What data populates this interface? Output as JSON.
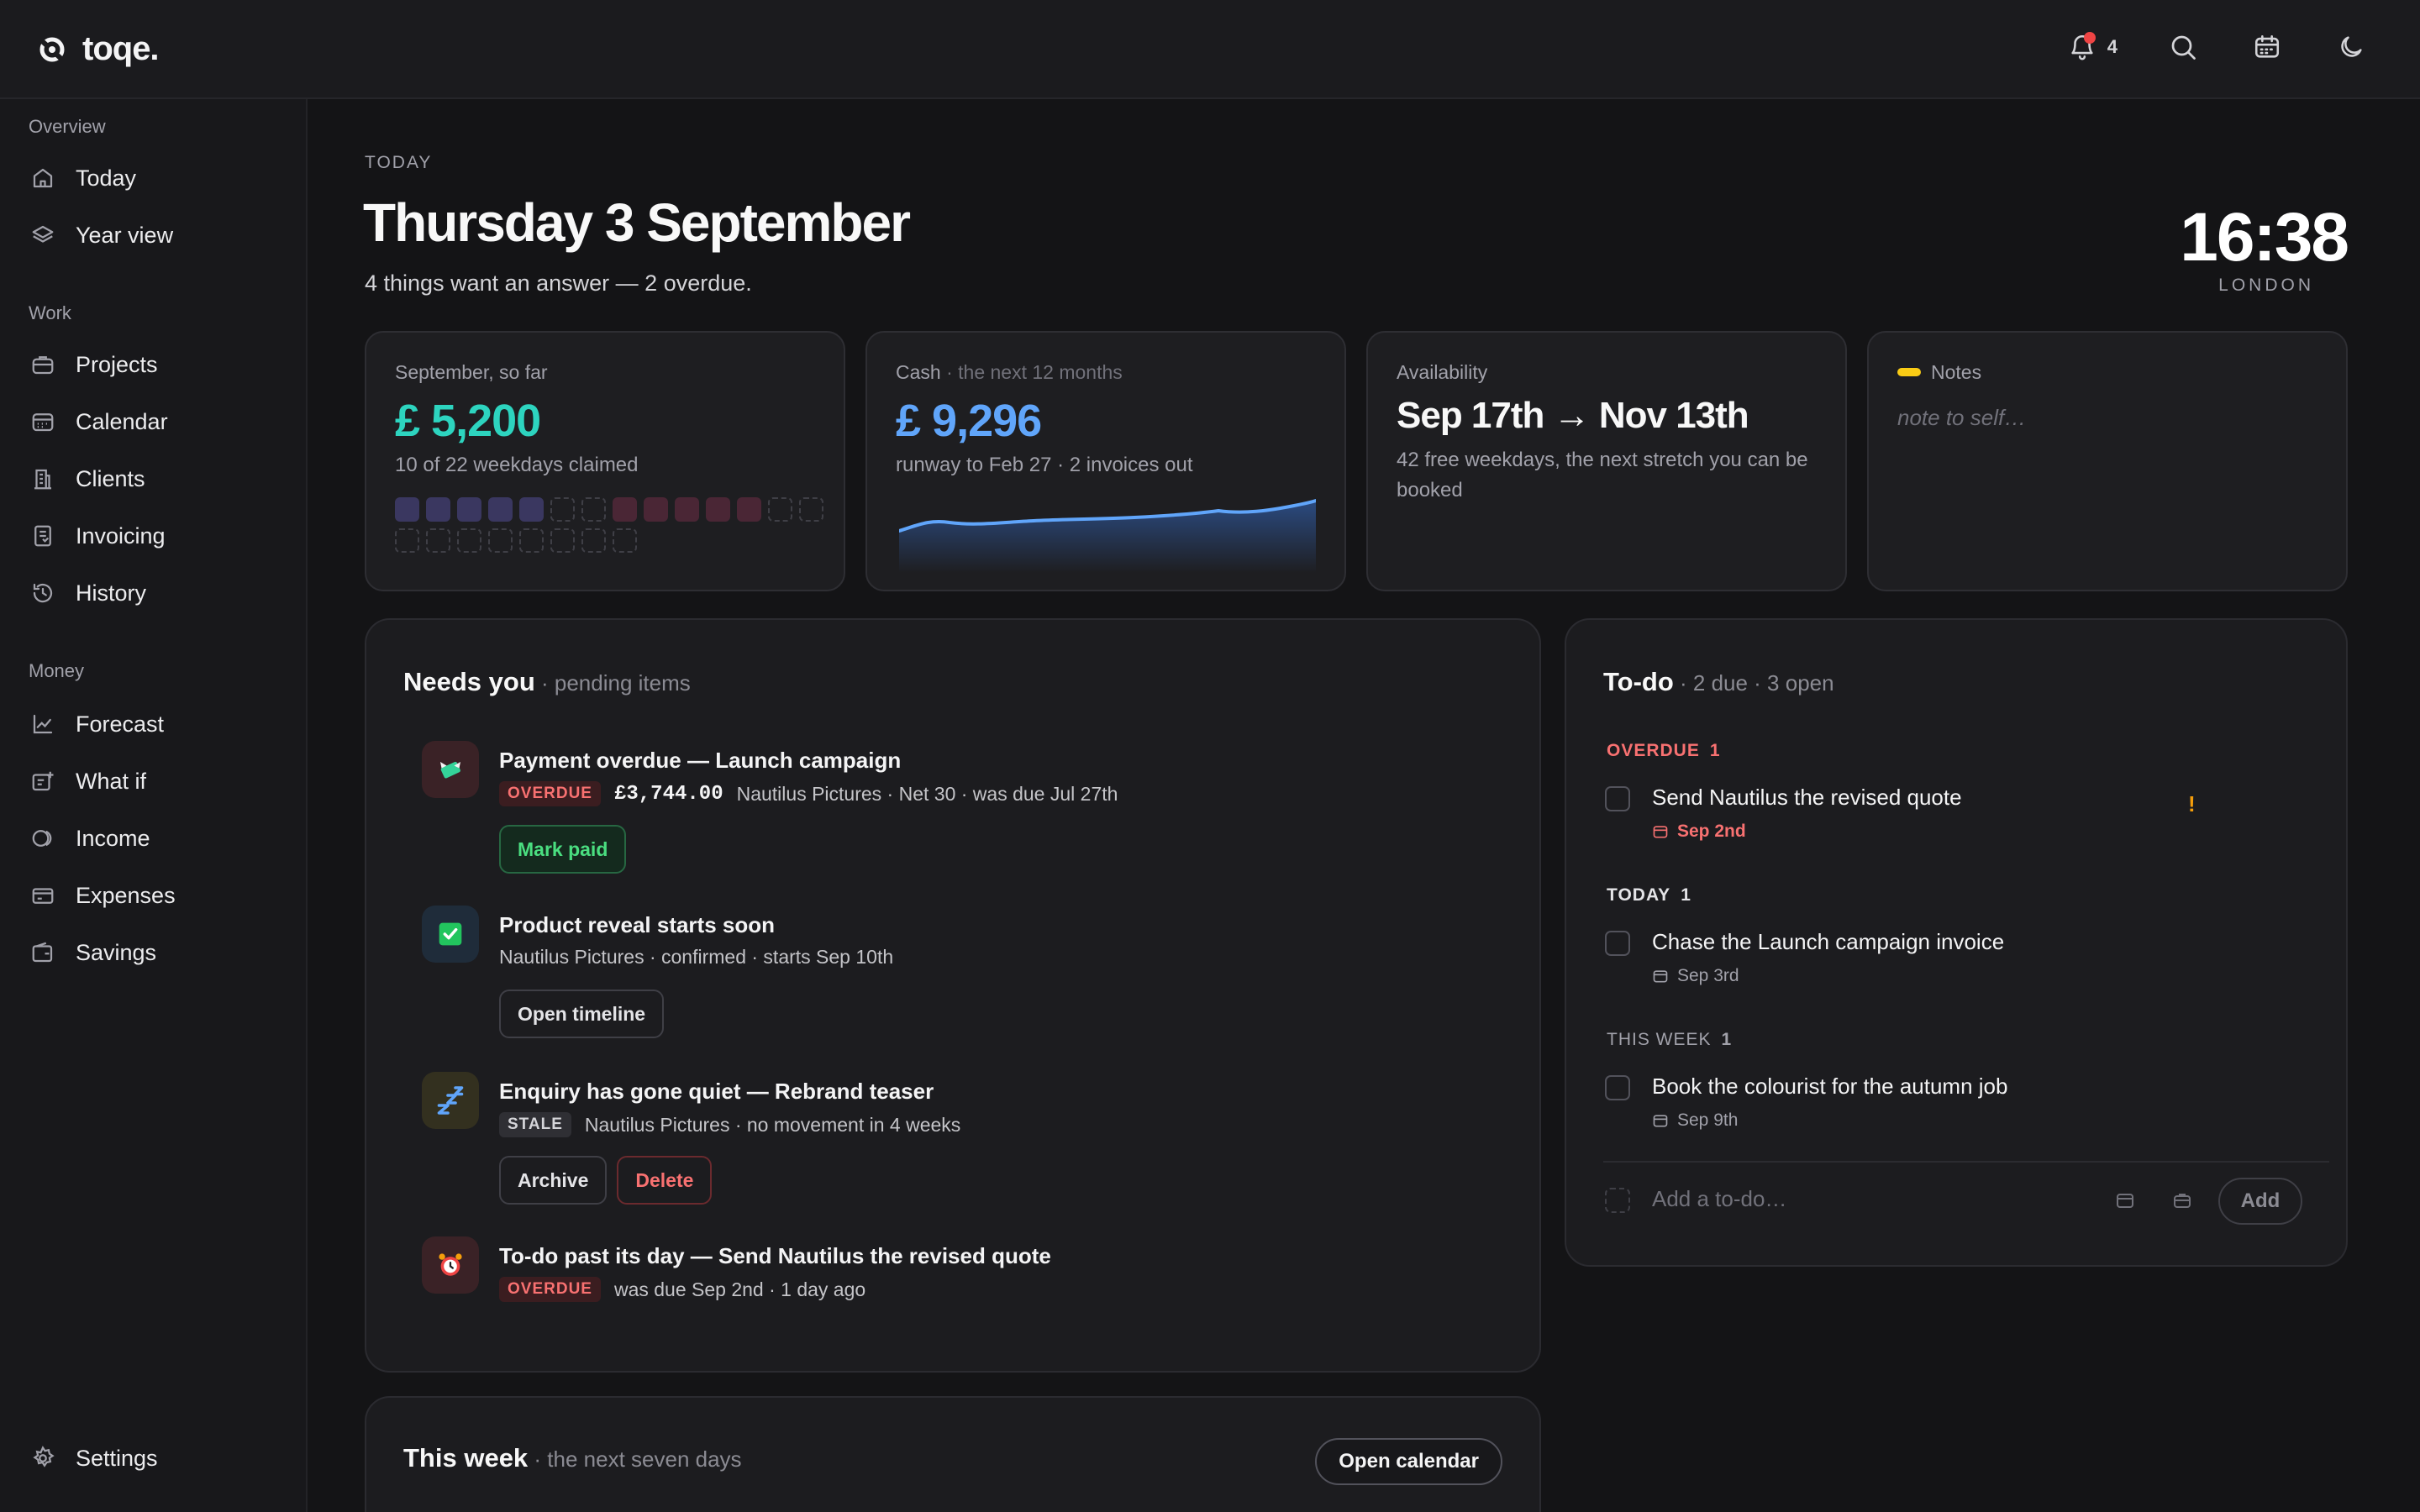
{
  "app": {
    "name": "toqe."
  },
  "topbar": {
    "notification_count": "4",
    "icons": [
      "bell-icon",
      "search-icon",
      "calendar-icon",
      "moon-icon"
    ]
  },
  "sidebar": {
    "sections": [
      {
        "label": "Overview",
        "items": [
          {
            "label": "Today",
            "icon": "home-icon"
          },
          {
            "label": "Year view",
            "icon": "layers-icon"
          }
        ]
      },
      {
        "label": "Work",
        "items": [
          {
            "label": "Projects",
            "icon": "briefcase-icon"
          },
          {
            "label": "Calendar",
            "icon": "calendar-icon"
          },
          {
            "label": "Clients",
            "icon": "building-icon"
          },
          {
            "label": "Invoicing",
            "icon": "receipt-icon"
          },
          {
            "label": "History",
            "icon": "history-icon"
          }
        ]
      },
      {
        "label": "Money",
        "items": [
          {
            "label": "Forecast",
            "icon": "trend-icon"
          },
          {
            "label": "What if",
            "icon": "scenario-icon"
          },
          {
            "label": "Income",
            "icon": "coin-icon"
          },
          {
            "label": "Expenses",
            "icon": "card-icon"
          },
          {
            "label": "Savings",
            "icon": "wallet-icon"
          }
        ]
      }
    ],
    "settings": {
      "label": "Settings",
      "icon": "gear-icon"
    }
  },
  "header": {
    "eyebrow": "TODAY",
    "title": "Thursday 3 September",
    "subtitle": "4 things want an answer — 2 overdue.",
    "clock": "16:38",
    "city": "LONDON"
  },
  "cards": {
    "september": {
      "label": "September, so far",
      "amount": "£ 5,200",
      "sub": "10 of 22 weekdays claimed",
      "amount_color": "#2dd4bf",
      "days": [
        "claimed",
        "claimed",
        "claimed",
        "claimed",
        "claimed",
        "free",
        "free",
        "booked",
        "booked",
        "booked",
        "booked",
        "booked",
        "free",
        "free",
        "free",
        "free",
        "free",
        "free",
        "free",
        "free",
        "free",
        "free"
      ]
    },
    "cash": {
      "label": "Cash",
      "label_muted": " · the next 12 months",
      "amount": "£ 9,296",
      "sub": "runway to Feb 27 · 2 invoices out",
      "amount_color": "#60a5fa"
    },
    "availability": {
      "label": "Availability",
      "title": "Sep 17th → Nov 13th",
      "sub": "42 free weekdays, the next stretch you can be booked"
    },
    "notes": {
      "label": "Notes",
      "placeholder": "note to self…"
    }
  },
  "needs_you": {
    "title": "Needs you",
    "subtitle": " · pending items",
    "items": [
      {
        "icon": "money-wings-icon",
        "title": "Payment overdue — Launch campaign",
        "badge": "OVERDUE",
        "amount": "£3,744.00",
        "meta": "Nautilus Pictures · Net 30 · was due Jul 27th",
        "buttons": [
          "Mark paid"
        ]
      },
      {
        "icon": "check-box-icon",
        "title": "Product reveal starts soon",
        "meta": "Nautilus Pictures · confirmed · starts Sep 10th",
        "buttons": [
          "Open timeline"
        ]
      },
      {
        "icon": "sleep-icon",
        "title": "Enquiry has gone quiet — Rebrand teaser",
        "badge": "STALE",
        "meta": "Nautilus Pictures · no movement in 4 weeks",
        "buttons": [
          "Archive",
          "Delete"
        ]
      },
      {
        "icon": "alarm-clock-icon",
        "title": "To-do past its day — Send Nautilus the revised quote",
        "badge": "OVERDUE",
        "meta": "was due Sep 2nd · 1 day ago"
      }
    ]
  },
  "todo": {
    "title": "To-do",
    "subtitle": " · 2 due · 3 open",
    "groups": [
      {
        "label": "OVERDUE",
        "count": "1",
        "color": "#f87171",
        "item": {
          "text": "Send Nautilus the revised quote",
          "date": "Sep 2nd",
          "flag": "!"
        }
      },
      {
        "label": "TODAY",
        "count": "1",
        "color": "#e4e4e7",
        "item": {
          "text": "Chase the Launch campaign invoice",
          "date": "Sep 3rd"
        }
      },
      {
        "label": "THIS WEEK",
        "count": "1",
        "color": "#a1a1aa",
        "item": {
          "text": "Book the colourist for the autumn job",
          "date": "Sep 9th"
        }
      }
    ],
    "add_placeholder": "Add a to-do…",
    "add_button": "Add"
  },
  "this_week": {
    "title": "This week",
    "subtitle": " · the next seven days",
    "button": "Open calendar"
  }
}
